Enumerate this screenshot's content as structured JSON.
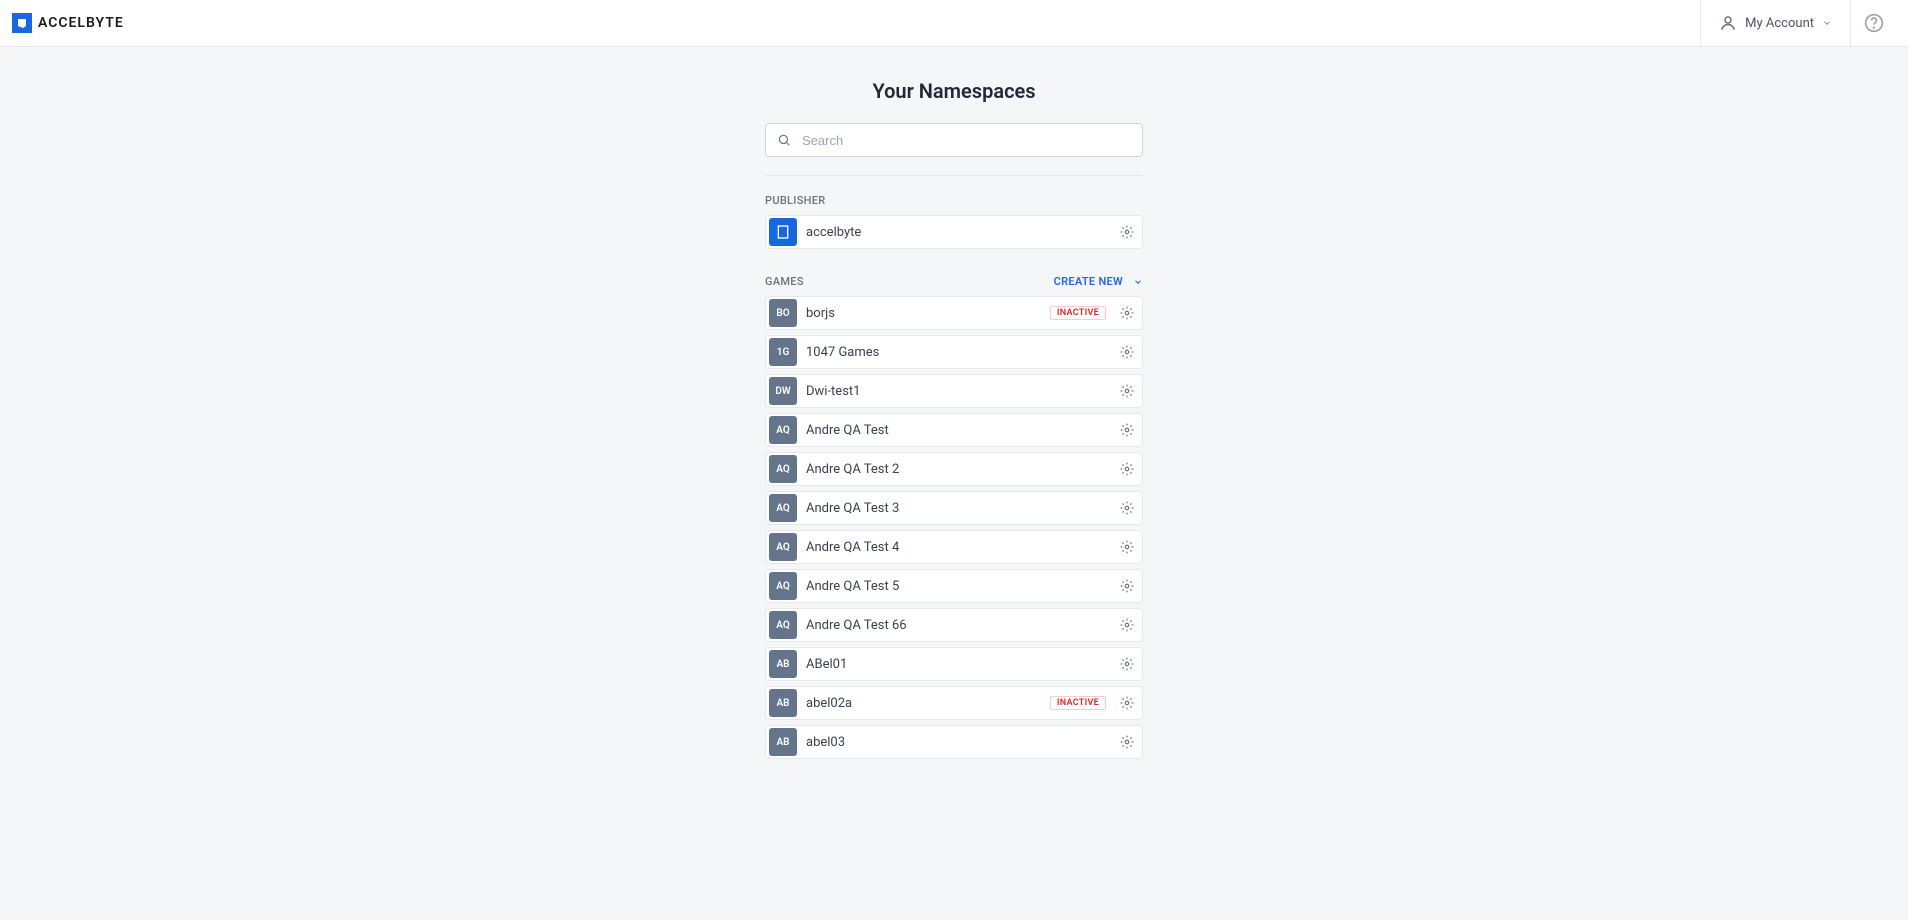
{
  "header": {
    "logo_text": "ACCELBYTE",
    "account_label": "My Account"
  },
  "page": {
    "title": "Your Namespaces",
    "search_placeholder": "Search"
  },
  "sections": {
    "publisher_label": "PUBLISHER",
    "games_label": "GAMES",
    "create_new_label": "CREATE NEW"
  },
  "publisher": {
    "name": "accelbyte"
  },
  "games": [
    {
      "initials": "BO",
      "name": "borjs",
      "status": "INACTIVE"
    },
    {
      "initials": "1G",
      "name": "1047 Games",
      "status": null
    },
    {
      "initials": "DW",
      "name": "Dwi-test1",
      "status": null
    },
    {
      "initials": "AQ",
      "name": "Andre QA Test",
      "status": null
    },
    {
      "initials": "AQ",
      "name": "Andre QA Test 2",
      "status": null
    },
    {
      "initials": "AQ",
      "name": "Andre QA Test 3",
      "status": null
    },
    {
      "initials": "AQ",
      "name": "Andre QA Test 4",
      "status": null
    },
    {
      "initials": "AQ",
      "name": "Andre QA Test 5",
      "status": null
    },
    {
      "initials": "AQ",
      "name": "Andre QA Test 66",
      "status": null
    },
    {
      "initials": "AB",
      "name": "ABel01",
      "status": null
    },
    {
      "initials": "AB",
      "name": "abel02a",
      "status": "INACTIVE"
    },
    {
      "initials": "AB",
      "name": "abel03",
      "status": null
    }
  ]
}
